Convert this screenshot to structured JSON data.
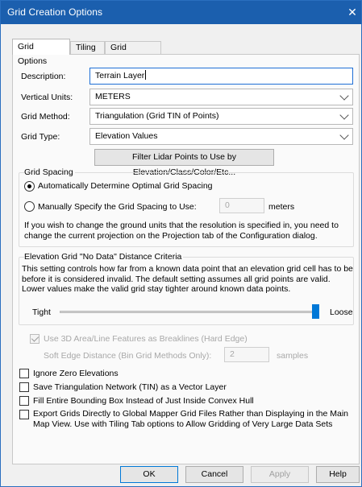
{
  "window": {
    "title": "Grid Creation Options"
  },
  "tabs": [
    {
      "label": "Grid Options",
      "active": true
    },
    {
      "label": "Tiling",
      "active": false
    },
    {
      "label": "Grid Bounds",
      "active": false
    }
  ],
  "form": {
    "description_label": "Description:",
    "description_value": "Terrain Layer",
    "vertical_units_label": "Vertical Units:",
    "vertical_units_value": "METERS",
    "grid_method_label": "Grid Method:",
    "grid_method_value": "Triangulation (Grid TIN of Points)",
    "grid_type_label": "Grid Type:",
    "grid_type_value": "Elevation Values",
    "filter_button": "Filter Lidar Points to Use by Elevation/Class/Color/Etc..."
  },
  "grid_spacing": {
    "title": "Grid Spacing",
    "auto_label": "Automatically Determine Optimal Grid Spacing",
    "auto_selected": true,
    "manual_label": "Manually Specify the Grid Spacing to Use:",
    "manual_value": "0",
    "manual_units": "meters",
    "note": "If you wish to change the ground units that the resolution is specified in, you need to change the current projection on the Projection tab of the Configuration dialog."
  },
  "no_data": {
    "title": "Elevation Grid \"No Data\" Distance Criteria",
    "description": "This setting controls how far from a known data point that an elevation grid cell has to be before it is considered invalid. The default setting assumes all grid points are valid. Lower values make the valid grid stay tighter around known data points.",
    "tight_label": "Tight",
    "loose_label": "Loose",
    "slider_value": 1.0
  },
  "options": {
    "breaklines_label": "Use 3D Area/Line Features as Breaklines (Hard Edge)",
    "breaklines_checked": true,
    "soft_edge_label": "Soft Edge Distance (Bin Grid Methods Only):",
    "soft_edge_value": "2",
    "soft_edge_units": "samples",
    "ignore_zero_label": "Ignore Zero Elevations",
    "save_tin_label": "Save Triangulation Network (TIN) as a Vector Layer",
    "fill_bbox_label": "Fill Entire Bounding Box Instead of Just Inside Convex Hull",
    "export_label": "Export Grids Directly to Global Mapper Grid Files Rather than Displaying in the Main Map View. Use with Tiling Tab options to Allow Gridding of Very Large Data Sets"
  },
  "buttons": {
    "ok": "OK",
    "cancel": "Cancel",
    "apply": "Apply",
    "help": "Help"
  },
  "icons": {
    "close": "close-icon",
    "dropdown": "chevron-down-icon"
  },
  "colors": {
    "titlebar": "#1b5fae",
    "accent": "#0078d7"
  }
}
